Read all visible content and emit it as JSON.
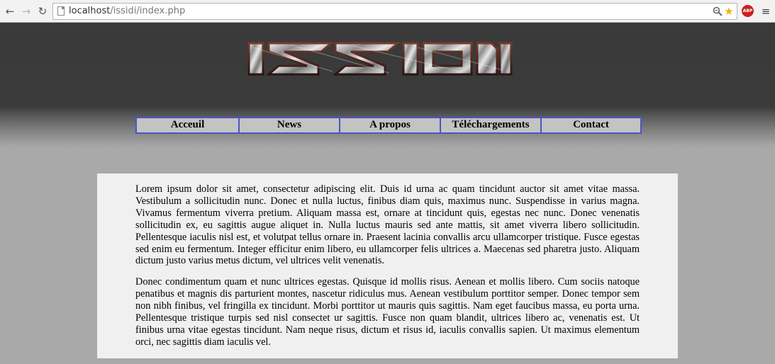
{
  "browser": {
    "url_host": "localhost",
    "url_path": "/issidi/index.php",
    "icons": {
      "back": "back-arrow-icon",
      "forward": "forward-arrow-icon",
      "reload": "reload-icon",
      "page": "page-icon",
      "zoom": "zoom-icon",
      "bookmark": "star-icon",
      "adblock": "abp-icon",
      "menu": "hamburger-menu-icon"
    },
    "adblock_label": "ABP"
  },
  "site": {
    "logo_text": "ISSIDI",
    "nav": [
      {
        "label": "Acceuil"
      },
      {
        "label": "News"
      },
      {
        "label": "A propos"
      },
      {
        "label": "Téléchargements"
      },
      {
        "label": "Contact"
      }
    ],
    "colors": {
      "header_dark": "#3b3b3b",
      "page_bg": "#a9a9a9",
      "nav_bg": "#c3c3c3",
      "nav_border": "#4a55c8",
      "content_bg": "#f0f0f0"
    }
  },
  "content": {
    "paragraphs": [
      "Lorem ipsum dolor sit amet, consectetur adipiscing elit. Duis id urna ac quam tincidunt auctor sit amet vitae massa. Vestibulum a sollicitudin nunc. Donec et nulla luctus, finibus diam quis, maximus nunc. Suspendisse in varius magna. Vivamus fermentum viverra pretium. Aliquam massa est, ornare at tincidunt quis, egestas nec nunc. Donec venenatis sollicitudin ex, eu sagittis augue aliquet in. Nulla luctus mauris sed ante mattis, sit amet viverra libero sollicitudin. Pellentesque iaculis nisl est, et volutpat tellus ornare in. Praesent lacinia convallis arcu ullamcorper tristique. Fusce egestas sed enim eu fermentum. Integer efficitur enim libero, eu ullamcorper felis ultrices a. Maecenas sed pharetra justo. Aliquam dictum justo varius metus dictum, vel ultrices velit venenatis.",
      "Donec condimentum quam et nunc ultrices egestas. Quisque id mollis risus. Aenean et mollis libero. Cum sociis natoque penatibus et magnis dis parturient montes, nascetur ridiculus mus. Aenean vestibulum porttitor semper. Donec tempor sem non nibh finibus, vel fringilla ex tincidunt. Morbi porttitor ut mauris quis sagittis. Nam eget faucibus massa, eu porta urna. Pellentesque tristique turpis sed nisl consectet ur sagittis. Fusce non quam blandit, ultrices libero ac, venenatis est. Ut finibus urna vitae egestas tincidunt. Nam neque risus, dictum et risus id, iaculis convallis sapien. Ut maximus elementum orci, nec sagittis diam iaculis vel."
    ]
  }
}
